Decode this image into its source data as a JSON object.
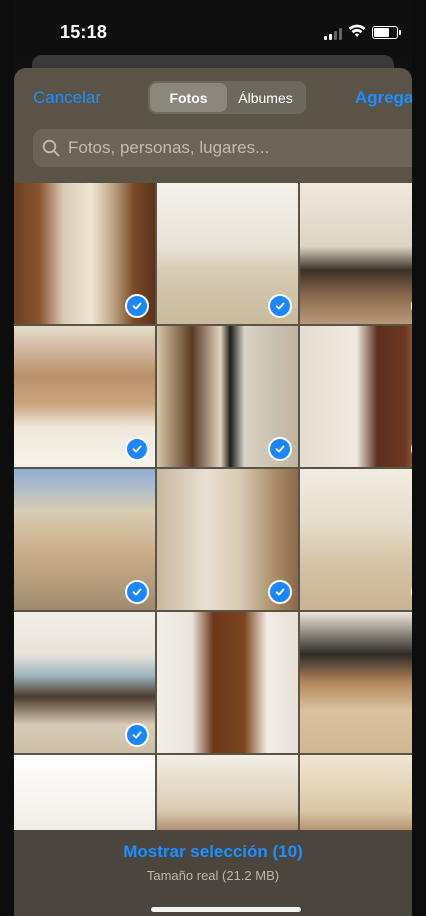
{
  "status_bar": {
    "time": "15:18",
    "signal_bars": 2,
    "wifi": true,
    "battery_level": 0.7
  },
  "nav": {
    "cancel_label": "Cancelar",
    "add_label": "Agregar",
    "tabs": [
      {
        "label": "Fotos",
        "active": true
      },
      {
        "label": "Álbumes",
        "active": false
      }
    ]
  },
  "search": {
    "placeholder": "Fotos, personas, lugares...",
    "value": ""
  },
  "photos": [
    {
      "selected": true,
      "desc": "hallway-wood-doors"
    },
    {
      "selected": true,
      "desc": "white-room-hallway"
    },
    {
      "selected": true,
      "desc": "kitchen-table"
    },
    {
      "selected": true,
      "desc": "room-chandelier"
    },
    {
      "selected": true,
      "desc": "bathroom-shower"
    },
    {
      "selected": true,
      "desc": "bedroom-wood-door"
    },
    {
      "selected": true,
      "desc": "patio-exterior"
    },
    {
      "selected": true,
      "desc": "bathroom-tiles"
    },
    {
      "selected": true,
      "desc": "empty-room"
    },
    {
      "selected": true,
      "desc": "living-room-window"
    },
    {
      "selected": false,
      "desc": "bedroom-door"
    },
    {
      "selected": false,
      "desc": "lobby-plants"
    },
    {
      "selected": false,
      "desc": "room-ceiling-fan"
    },
    {
      "selected": false,
      "desc": "vanity-mirror"
    },
    {
      "selected": false,
      "desc": "bathroom-sink"
    }
  ],
  "bottom": {
    "show_selection_label": "Mostrar selección (10)",
    "real_size_label": "Tamaño real (21.2 MB)"
  },
  "colors": {
    "accent": "#1f8fff",
    "check_blue": "#1a86ff",
    "sheet_bg": "#5a5448"
  }
}
